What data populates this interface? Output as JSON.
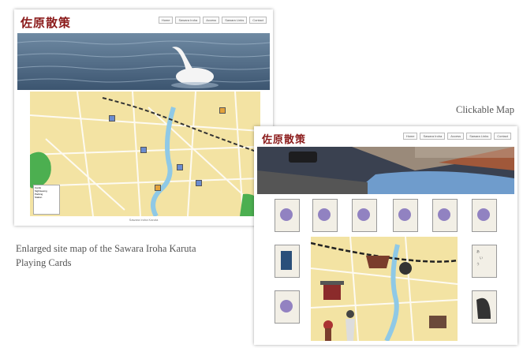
{
  "left_screenshot": {
    "logo": "佐原散策",
    "nav": [
      "Home",
      "Sawara Iroha",
      "Access",
      "Sawara Links",
      "Contact"
    ],
    "map_footer": "Sawara Iroha Karuta",
    "legend": [
      "Cards",
      "Sightseeing",
      "Parking",
      "Station"
    ]
  },
  "right_screenshot": {
    "logo": "佐原散策",
    "nav": [
      "Home",
      "Sawara Iroha",
      "Access",
      "Sawara Links",
      "Contact"
    ]
  },
  "captions": {
    "left": "Enlarged site map of the Sawara Iroha Karuta",
    "left_line2": "Playing Cards",
    "right": "Clickable Map"
  },
  "colors": {
    "logo": "#8b1a1a",
    "map_bg": "#f3e3a3",
    "river": "#8fc9e6",
    "park": "#4caf50"
  }
}
